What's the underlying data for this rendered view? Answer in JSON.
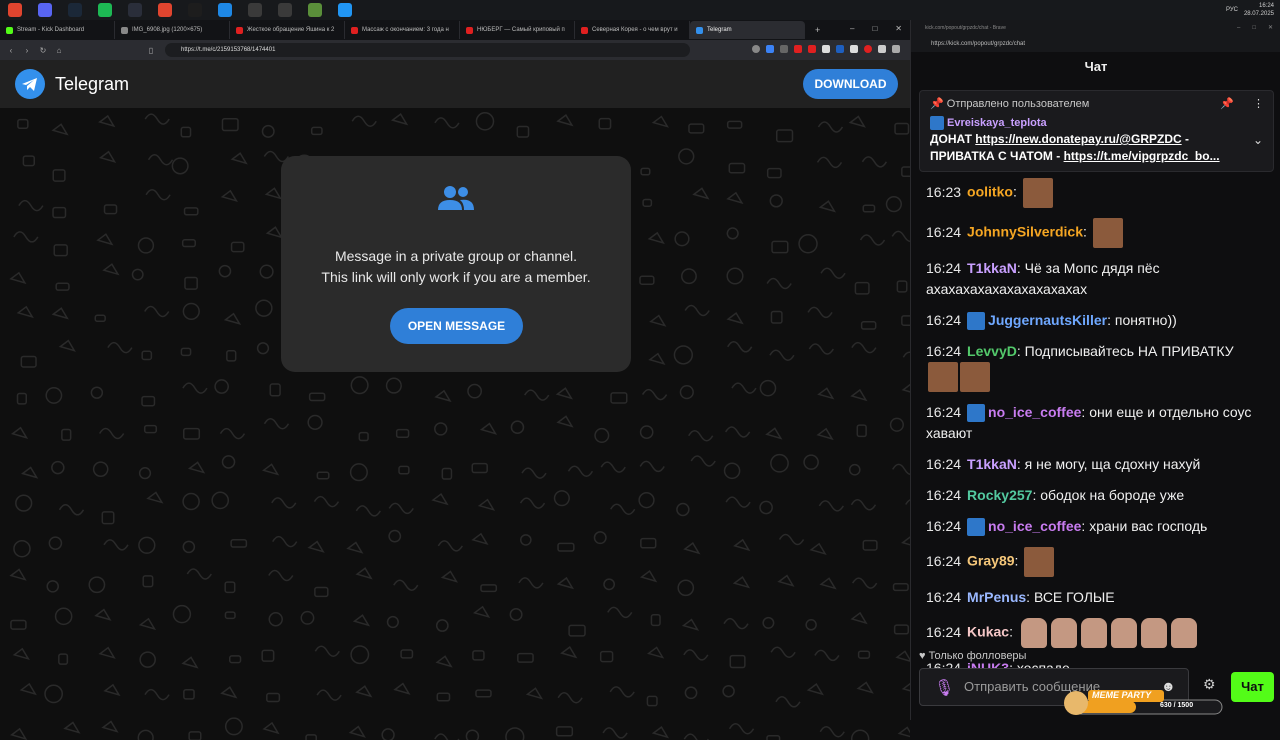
{
  "taskbar": {
    "lang": "РУС",
    "time": "16:24",
    "date": "28.07.2025",
    "app_colors": [
      "#e0452f",
      "#5865f2",
      "#1b2838",
      "#1db954",
      "#2a2e3a",
      "#e0452f",
      "#1d1d1d",
      "#1e88e5",
      "#3a3a3a",
      "#3a3a3a",
      "#5a8f3a",
      "#2196f3"
    ]
  },
  "left_browser": {
    "tabs": [
      {
        "label": "Stream - Kick Dashboard",
        "color": "#53fc18"
      },
      {
        "label": "IMG_6908.jpg (1200×675)",
        "color": "#888888"
      },
      {
        "label": "Жесткое обращение Яшина к 2",
        "color": "#e02020"
      },
      {
        "label": "Массаж с окончанием: 3 года н",
        "color": "#e02020"
      },
      {
        "label": "НЮБЕРГ — Самый криповый п",
        "color": "#e02020"
      },
      {
        "label": "Северная Корея - о чем врут и",
        "color": "#e02020"
      },
      {
        "label": "Telegram",
        "color": "#3390ec"
      }
    ],
    "url": "https://t.me/c/2159153768/1474401"
  },
  "telegram": {
    "brand": "Telegram",
    "download_label": "DOWNLOAD",
    "line1": "Message in a private group or channel.",
    "line2": "This link will only work if you are a member.",
    "open_label": "OPEN MESSAGE",
    "accent": "#2f7fd8"
  },
  "kick": {
    "titlebar": "kick.com/popout/grpzdc/chat - Brave",
    "url": "https://kick.com/popout/grpzdc/chat",
    "chat_title": "Чат",
    "pinned": {
      "header": "Отправлено пользователем",
      "user": "Evreiskaya_teplota",
      "text_prefix": "ДОНАТ ",
      "link1": "https://new.donatepay.ru/@GRPZDC",
      "text_mid": " - ПРИВАТКА С ЧАТОМ - ",
      "link2": "https://t.me/vipgrpzdc_bo..."
    },
    "messages": [
      {
        "time": "16:23",
        "user": "oolitko",
        "color": "#f5a623",
        "badge": false,
        "text": "",
        "emotes": 1,
        "face": false
      },
      {
        "time": "16:24",
        "user": "JohnnySilverdick",
        "color": "#f5a623",
        "badge": false,
        "text": "",
        "emotes": 1,
        "face": false
      },
      {
        "time": "16:24",
        "user": "T1kkaN",
        "color": "#c9a0ff",
        "badge": false,
        "text": "Чё за Мопс дядя пёс ахахахахахахахахахахах",
        "emotes": 0,
        "face": false
      },
      {
        "time": "16:24",
        "user": "JuggernautsKiller",
        "color": "#6fa8ff",
        "badge": true,
        "text": "понятно))",
        "emotes": 0,
        "face": false
      },
      {
        "time": "16:24",
        "user": "LevvyD",
        "color": "#53c96b",
        "badge": false,
        "text": "Подписывайтесь НА ПРИВАТКУ",
        "emotes": 2,
        "face": false
      },
      {
        "time": "16:24",
        "user": "no_ice_coffee",
        "color": "#c87cf0",
        "badge": true,
        "text": "они еще и отдельно соус хавают",
        "emotes": 0,
        "face": false
      },
      {
        "time": "16:24",
        "user": "T1kkaN",
        "color": "#c9a0ff",
        "badge": false,
        "text": "я не могу, ща сдохну нахуй",
        "emotes": 0,
        "face": false
      },
      {
        "time": "16:24",
        "user": "Rocky257",
        "color": "#53c9a0",
        "badge": false,
        "text": "ободок на бороде уже",
        "emotes": 0,
        "face": false
      },
      {
        "time": "16:24",
        "user": "no_ice_coffee",
        "color": "#c87cf0",
        "badge": true,
        "text": "храни вас господь",
        "emotes": 0,
        "face": false
      },
      {
        "time": "16:24",
        "user": "Gray89",
        "color": "#f5c77a",
        "badge": false,
        "text": "",
        "emotes": 1,
        "face": false
      },
      {
        "time": "16:24",
        "user": "MrPenus",
        "color": "#9ab8ff",
        "badge": false,
        "text": "ВСЕ ГОЛЫЕ",
        "emotes": 0,
        "face": false
      },
      {
        "time": "16:24",
        "user": "Kukac",
        "color": "#f5c7c7",
        "badge": false,
        "text": "",
        "emotes": 6,
        "face": true
      },
      {
        "time": "16:24",
        "user": "iNUK3",
        "color": "#c87cf0",
        "badge": false,
        "text": "хоспаде",
        "emotes": 0,
        "face": false
      }
    ],
    "followers_only": "Только фолловеры",
    "input_placeholder": "Отправить сообщение",
    "send_label": "Чат",
    "accent": "#53fc18"
  },
  "overlay": {
    "title": "MEME PARTY",
    "progress": "630 / 1500",
    "progress_value": 0.42
  }
}
